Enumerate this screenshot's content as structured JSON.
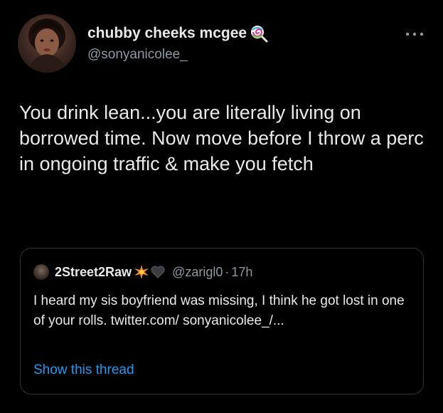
{
  "tweet": {
    "author": {
      "display_name": "chubby cheeks mcgee",
      "emoji_icon": "lollipop-icon",
      "handle": "@sonyanicolee_"
    },
    "more_icon": "more-icon",
    "text": "You drink lean...you are literally living on borrowed time. Now move before I throw a perc in ongoing traffic & make you fetch"
  },
  "quote": {
    "author": {
      "display_name": "2Street2Raw",
      "icons": [
        "sparkle-icon",
        "black-heart-icon"
      ],
      "handle": "@zarigl0",
      "separator": "·",
      "time": "17h"
    },
    "text": "I heard my sis boyfriend was missing, I think he got lost in one of your rolls. twitter.com/ sonyanicolee_/...",
    "show_thread": "Show this thread"
  },
  "colors": {
    "background": "#000000",
    "text_primary": "#e7e9ea",
    "text_secondary": "#8b98a5",
    "link": "#1d9bf0",
    "border": "#2f3336"
  }
}
